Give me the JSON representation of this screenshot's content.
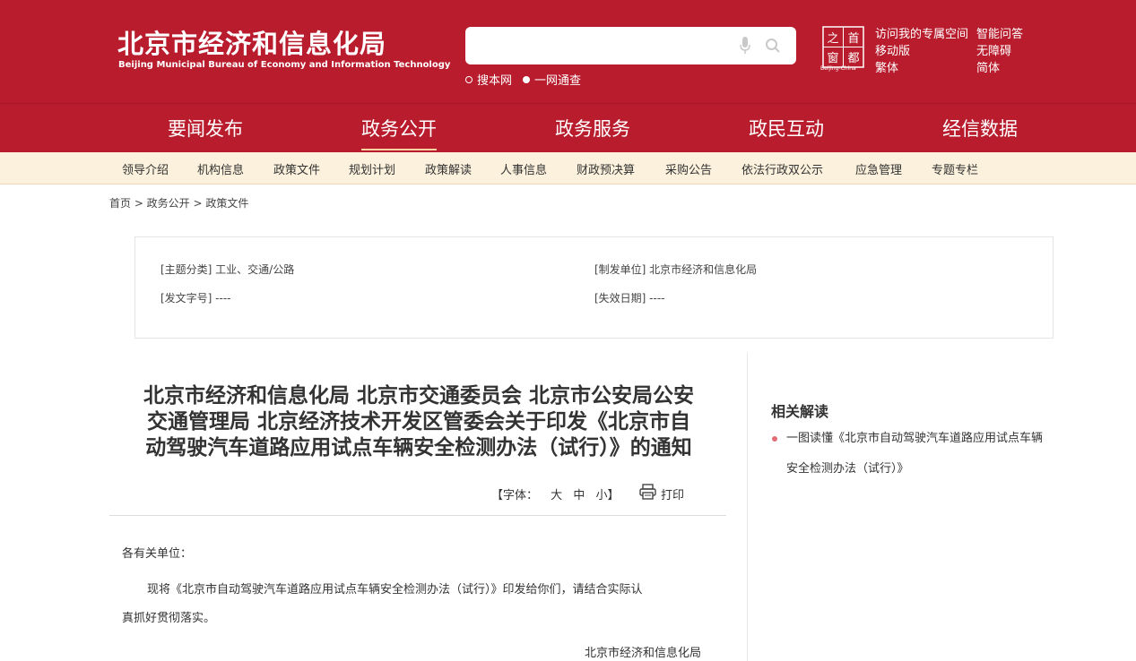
{
  "header": {
    "org_name_cn": "北京市经济和信息化局",
    "org_name_en": "Beijing Municipal Bureau of Economy and Information Technology",
    "search": {
      "placeholder": "",
      "scope_site": "搜本网",
      "scope_all": "一网通查"
    },
    "capital_logo_chars": [
      "之",
      "首",
      "都",
      "窗"
    ],
    "capital_logo_sub": "Beijing-China",
    "links": {
      "visit_space": "访问我的专属空间",
      "smart_qa": "智能问答",
      "mobile": "移动版",
      "accessibility": "无障碍",
      "traditional": "繁体",
      "simplified": "简体"
    }
  },
  "nav": {
    "items": [
      "要闻发布",
      "政务公开",
      "政务服务",
      "政民互动",
      "经信数据"
    ],
    "active_index": 1
  },
  "subnav": {
    "items": [
      "领导介绍",
      "机构信息",
      "政策文件",
      "规划计划",
      "政策解读",
      "人事信息",
      "财政预决算",
      "采购公告",
      "依法行政双公示",
      "应急管理",
      "专题专栏"
    ]
  },
  "breadcrumb": "首页 > 政务公开 > 政策文件",
  "info": {
    "topic": "[主题分类] 工业、交通/公路",
    "issuer": "[制发单位] 北京市经济和信息化局",
    "doc_no": "[发文字号] ----",
    "expiry": "[失效日期] ----"
  },
  "article": {
    "title_lines": [
      "北京市经济和信息化局 北京市交通委员会 北京市公安局公安",
      "交通管理局 北京经济技术开发区管委会关于印发《北京市自",
      "动驾驶汽车道路应用试点车辆安全检测办法（试行）》的通知"
    ],
    "font_label": "【字体：",
    "font_large": "大",
    "font_medium": "中",
    "font_small": "小】",
    "print_label": "打印",
    "salutation": "各有关单位：",
    "body_line1": "现将《北京市自动驾驶汽车道路应用试点车辆安全检测办法（试行）》印发给你们，请结合实际认",
    "body_line2": "真抓好贯彻落实。",
    "signature": "北京市经济和信息化局"
  },
  "sidebar": {
    "title": "相关解读",
    "link_line1": "一图读懂《北京市自动驾驶汽车道路应用试点车辆",
    "link_line2": "安全检测办法（试行）》"
  },
  "colors": {
    "brand_red": "#b81c2d",
    "subnav_bg": "#fbf1dc",
    "bullet_pink": "#e36d76"
  }
}
